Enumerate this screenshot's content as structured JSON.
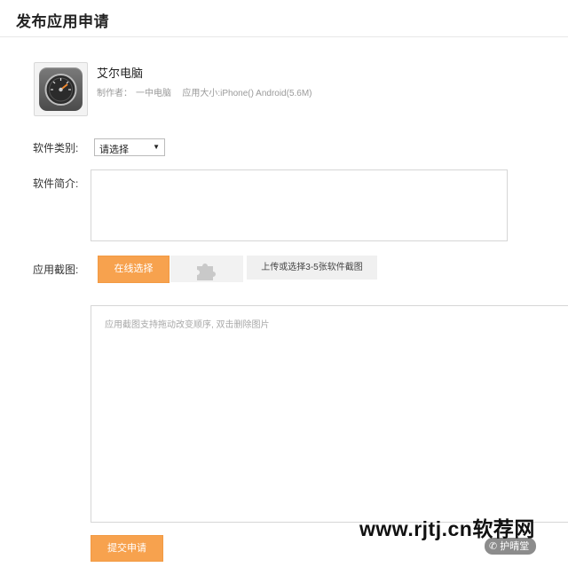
{
  "header": {
    "title": "发布应用申请"
  },
  "app": {
    "icon": "speedometer-icon",
    "name": "艾尔电脑",
    "author_label": "制作者：",
    "author": "一中电脑",
    "size_text": "应用大小:iPhone() Android(5.6M)"
  },
  "form": {
    "category_label": "软件类别:",
    "category_selected": "请选择",
    "intro_label": "软件简介:",
    "intro_value": "",
    "screenshot_label": "应用截图:",
    "online_select_button": "在线选择",
    "upload_icon": "puzzle-icon",
    "upload_hint": "上传或选择3-5张软件截图",
    "screenshot_area_hint": "应用截图支持拖动改变顺序, 双击删除图片",
    "submit_button": "提交申请"
  },
  "overlay": {
    "watermark": "www.rjtj.cn软荐网",
    "wechat_account": "护晴堂"
  },
  "colors": {
    "accent": "#f7a24e",
    "border": "#d6d6d6"
  }
}
